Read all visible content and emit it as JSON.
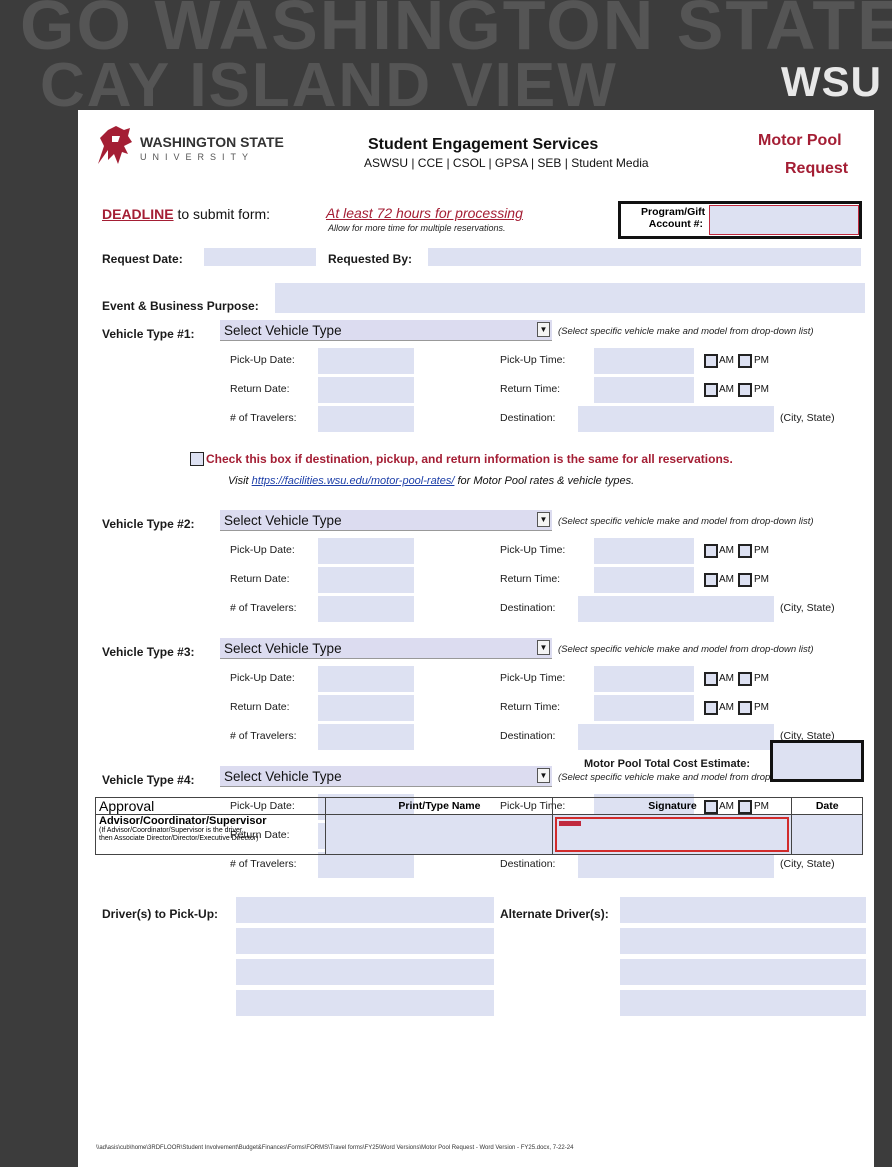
{
  "background": {
    "watermark_line1": "GO WASHINGTON STATE",
    "watermark_line2": "CAY ISLAND VIEW",
    "badge": "WSU"
  },
  "header": {
    "logo_line1": "WASHINGTON STATE",
    "logo_line2": "UNIVERSITY",
    "title": "Student Engagement Services",
    "subtitle": "ASWSU | CCE | CSOL | GPSA | SEB | Student Media",
    "form_title_line1": "Motor Pool",
    "form_title_line2": "Request",
    "accent_color": "#a41e34"
  },
  "deadline": {
    "label_highlight": "DEADLINE",
    "label_rest": " to submit form:",
    "value": "At least 72 hours for processing",
    "note": "Allow for more time for multiple reservations.",
    "account_label_1": "Program/Gift",
    "account_label_2": "Account #:"
  },
  "request": {
    "date_label": "Request Date:",
    "by_label": "Requested By:",
    "purpose_label": "Event & Business Purpose:"
  },
  "vehicle_labels": {
    "select_placeholder": "Select Vehicle Type",
    "select_hint": "(Select specific vehicle make and model from drop-down list)",
    "pickup_date": "Pick-Up Date:",
    "return_date": "Return Date:",
    "travelers": "# of Travelers:",
    "pickup_time": "Pick-Up Time:",
    "return_time": "Return Time:",
    "destination": "Destination:",
    "am": "AM",
    "pm": "PM",
    "city_state": "(City, State)"
  },
  "vehicles": [
    {
      "label": "Vehicle Type #1:"
    },
    {
      "label": "Vehicle Type #2:"
    },
    {
      "label": "Vehicle Type #3:"
    },
    {
      "label": "Vehicle Type #4:"
    }
  ],
  "same_info": {
    "checkbox_text": "Check this box if destination, pickup, and return information is the same for all reservations.",
    "visit_prefix": "Visit ",
    "visit_link": "https://facilities.wsu.edu/motor-pool-rates/",
    "visit_suffix": " for Motor Pool rates & vehicle types."
  },
  "drivers": {
    "pickup_label": "Driver(s) to Pick-Up:",
    "alternate_label": "Alternate Driver(s):"
  },
  "total": {
    "label": "Motor Pool Total Cost Estimate:"
  },
  "approval": {
    "header": "Approval",
    "col_name": "Print/Type Name",
    "col_signature": "Signature",
    "col_date": "Date",
    "role": "Advisor/Coordinator/Supervisor",
    "role_note_1": "(If Advisor/Coordinator/Supervisor is the driver,",
    "role_note_2": "then Associate Director/Director/Executive Director)"
  },
  "footer": {
    "path": "\\\\ad\\asis\\cub\\home\\3RDFLOOR\\Student Involvement\\Budget&Finances\\Forms\\FORMS\\Travel forms\\FY25\\Word Versions\\Motor Pool Request - Word Version - FY25.docx, 7-22-24"
  }
}
